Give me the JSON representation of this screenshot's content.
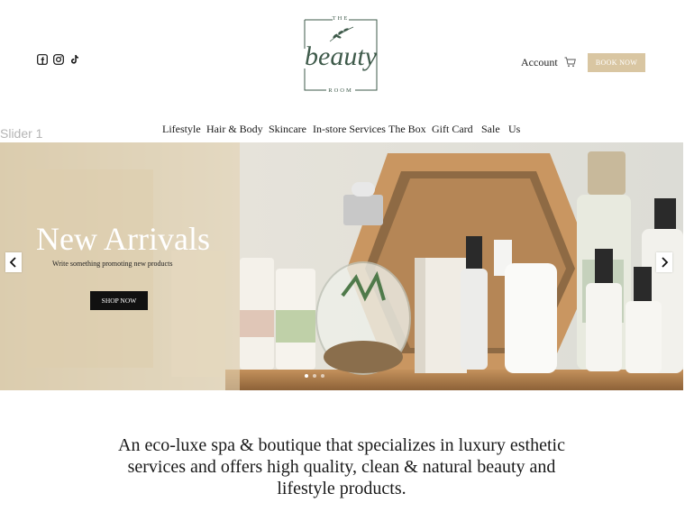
{
  "header": {
    "social_icons": [
      "facebook-icon",
      "instagram-icon",
      "tiktok-icon"
    ],
    "logo": {
      "top": "THE",
      "middle": "beauty",
      "bottom": "ROOM"
    },
    "account_label": "Account",
    "cart_icon": "cart-icon",
    "book_label": "BOOK NOW"
  },
  "slider_label": "Slider 1",
  "nav": {
    "items": [
      "Lifestyle",
      "Hair & Body",
      "Skincare",
      "In-store Services",
      "The Box",
      "Gift Card",
      "Sale",
      "Us"
    ]
  },
  "hero": {
    "title": "New Arrivals",
    "subtitle": "Write something promoting new products",
    "cta_label": "SHOP NOW",
    "slides_count": 3,
    "active_slide": 1
  },
  "tagline": "An eco-luxe spa & boutique that specializes in luxury esthetic services and offers high quality, clean & natural beauty and lifestyle products.",
  "colors": {
    "accent": "#d9c6a2",
    "overlay": "#e2d2b2",
    "logo_green": "#3e5a4a",
    "button_dark": "#111111"
  }
}
